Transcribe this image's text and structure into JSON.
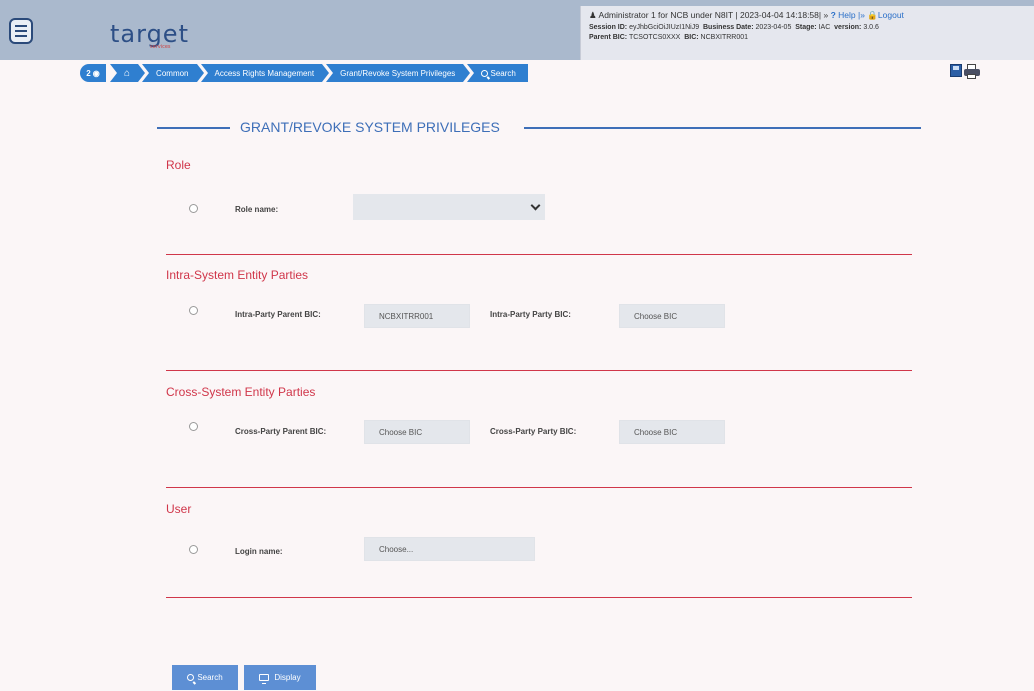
{
  "header": {
    "logo_text": "target",
    "logo_subtext": "services",
    "user_info": "Administrator 1 for NCB under N8IT",
    "timestamp": "| 2023-04-04 14:18:58| »",
    "help_label": "Help",
    "separator": "|»",
    "logout_label": "Logout",
    "session_id_label": "Session ID:",
    "session_id_value": "eyJhbGciOiJIUzI1NiJ9",
    "business_date_label": "Business Date:",
    "business_date_value": "2023-04-05",
    "stage_label": "Stage:",
    "stage_value": "IAC",
    "version_label": "version:",
    "version_value": "3.0.6",
    "parent_bic_label": "Parent BIC:",
    "parent_bic_value": "TCSOTCS0XXX",
    "bic_label": "BIC:",
    "bic_value": "NCBXITRR001"
  },
  "breadcrumb": {
    "badge": "2",
    "items": [
      "Common",
      "Access Rights Management",
      "Grant/Revoke System Privileges",
      "Search"
    ]
  },
  "page_title": "GRANT/REVOKE SYSTEM PRIVILEGES",
  "sections": {
    "role": {
      "title": "Role",
      "role_name_label": "Role name:",
      "role_name_value": ""
    },
    "intra": {
      "title": "Intra-System Entity Parties",
      "parent_bic_label": "Intra-Party Parent BIC:",
      "parent_bic_value": "NCBXITRR001",
      "party_bic_label": "Intra-Party Party BIC:",
      "party_bic_placeholder": "Choose BIC"
    },
    "cross": {
      "title": "Cross-System Entity Parties",
      "parent_bic_label": "Cross-Party Parent BIC:",
      "parent_bic_placeholder": "Choose BIC",
      "party_bic_label": "Cross-Party Party BIC:",
      "party_bic_placeholder": "Choose BIC"
    },
    "user": {
      "title": "User",
      "login_name_label": "Login name:",
      "login_name_placeholder": "Choose..."
    }
  },
  "buttons": {
    "search_label": "Search",
    "display_label": "Display"
  }
}
